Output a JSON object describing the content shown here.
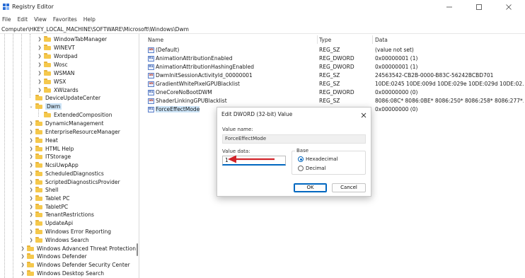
{
  "window": {
    "title": "Registry Editor"
  },
  "menu": {
    "items": [
      "File",
      "Edit",
      "View",
      "Favorites",
      "Help"
    ]
  },
  "address": "Computer\\HKEY_LOCAL_MACHINE\\SOFTWARE\\Microsoft\\Windows\\Dwm",
  "tree": {
    "items": [
      {
        "label": "WindowTabManager",
        "expandable": true
      },
      {
        "label": "WINEVT",
        "expandable": true
      },
      {
        "label": "Wordpad",
        "expandable": true
      },
      {
        "label": "Wosc",
        "expandable": true
      },
      {
        "label": "WSMAN",
        "expandable": true
      },
      {
        "label": "WSX",
        "expandable": true
      },
      {
        "label": "XWizards",
        "expandable": true
      },
      {
        "label": "DeviceUpdateCenter",
        "expandable": false
      },
      {
        "label": "Dwm",
        "expandable": true,
        "expanded": true,
        "selected": true
      },
      {
        "label": "ExtendedComposition",
        "expandable": false
      },
      {
        "label": "DynamicManagement",
        "expandable": true
      },
      {
        "label": "EnterpriseResourceManager",
        "expandable": true
      },
      {
        "label": "Heat",
        "expandable": true
      },
      {
        "label": "HTML Help",
        "expandable": true
      },
      {
        "label": "ITStorage",
        "expandable": true
      },
      {
        "label": "NcsiUwpApp",
        "expandable": true
      },
      {
        "label": "ScheduledDiagnostics",
        "expandable": true
      },
      {
        "label": "ScriptedDiagnosticsProvider",
        "expandable": true
      },
      {
        "label": "Shell",
        "expandable": true
      },
      {
        "label": "Tablet PC",
        "expandable": true
      },
      {
        "label": "TabletPC",
        "expandable": true
      },
      {
        "label": "TenantRestrictions",
        "expandable": true
      },
      {
        "label": "UpdateApi",
        "expandable": true
      },
      {
        "label": "Windows Error Reporting",
        "expandable": true
      },
      {
        "label": "Windows Search",
        "expandable": true
      },
      {
        "label": "Windows Advanced Threat Protection",
        "expandable": true
      },
      {
        "label": "Windows Defender",
        "expandable": true
      },
      {
        "label": "Windows Defender Security Center",
        "expandable": true
      },
      {
        "label": "Windows Desktop Search",
        "expandable": true
      }
    ]
  },
  "list": {
    "headers": {
      "name": "Name",
      "type": "Type",
      "data": "Data"
    },
    "rows": [
      {
        "name": "(Default)",
        "type": "REG_SZ",
        "data": "(value not set)",
        "icon": "ab"
      },
      {
        "name": "AnimationAttributionEnabled",
        "type": "REG_DWORD",
        "data": "0x00000001 (1)",
        "icon": "dword"
      },
      {
        "name": "AnimationAttributionHashingEnabled",
        "type": "REG_DWORD",
        "data": "0x00000001 (1)",
        "icon": "dword"
      },
      {
        "name": "DwmInitSessionActivityId_00000001",
        "type": "REG_SZ",
        "data": "24563542-CB2B-0000-B83C-56242BCBD701",
        "icon": "ab"
      },
      {
        "name": "GradientWhitePixelGPUBlacklist",
        "type": "REG_SZ",
        "data": "10DE:0245 10DE:009d 10DE:029e 10DE:029d 10DE:02...",
        "icon": "ab"
      },
      {
        "name": "OneCoreNoBootDWM",
        "type": "REG_DWORD",
        "data": "0x00000000 (0)",
        "icon": "dword"
      },
      {
        "name": "ShaderLinkingGPUBlacklist",
        "type": "REG_SZ",
        "data": "8086:08C* 8086:0BE* 8086:250* 8086:258* 8086:277*...",
        "icon": "ab"
      },
      {
        "name": "ForceEffectMode",
        "type": "REG_DWORD",
        "data": "0x00000000 (0)",
        "icon": "dword",
        "highlight": true
      }
    ]
  },
  "dialog": {
    "title": "Edit DWORD (32-bit) Value",
    "value_name_label": "Value name:",
    "value_name": "ForceEffectMode",
    "value_data_label": "Value data:",
    "value_data": "1",
    "base_label": "Base",
    "hex_label": "Hexadecimal",
    "dec_label": "Decimal",
    "base_selected": "Hexadecimal",
    "ok_label": "OK",
    "cancel_label": "Cancel"
  },
  "colors": {
    "accent": "#0067c0",
    "annotation_arrow": "#d1232a",
    "folder": "#f5c84c",
    "selection": "#cce4f7"
  }
}
